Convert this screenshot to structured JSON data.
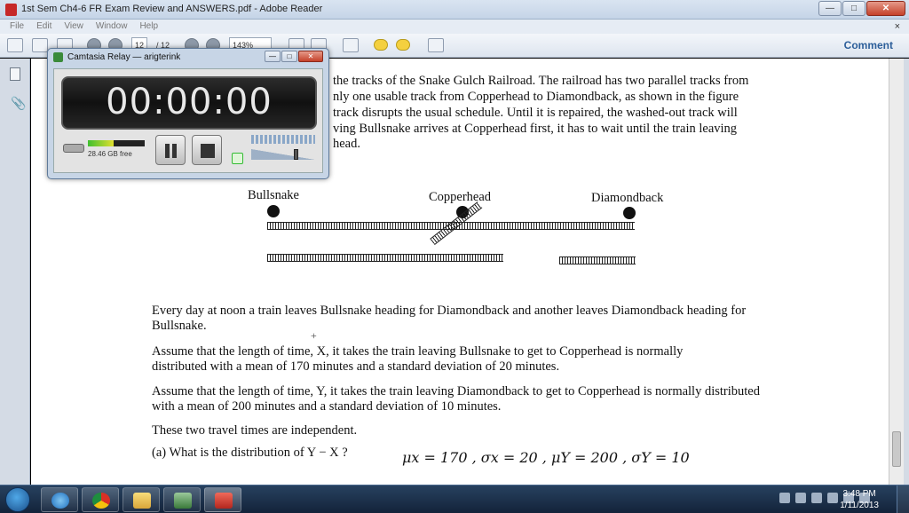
{
  "window": {
    "title": "1st Sem Ch4-6 FR Exam Review and ANSWERS.pdf - Adobe Reader",
    "minimize": "—",
    "maximize": "□",
    "close": "✕"
  },
  "menu": {
    "items": [
      "File",
      "Edit",
      "View",
      "Window",
      "Help"
    ],
    "close_doc": "×"
  },
  "toolbar": {
    "page_current": "12",
    "page_total": "/ 12",
    "zoom": "143%",
    "comment": "Comment"
  },
  "document": {
    "lines_top": [
      "the tracks of the Snake Gulch Railroad. The railroad has two parallel tracks from",
      "nly one usable track from Copperhead to Diamondback, as shown in the figure",
      "track disrupts the usual schedule. Until it is repaired, the washed-out track will",
      "ving Bullsnake arrives at Copperhead first, it has to wait until the train leaving",
      "head."
    ],
    "stations": [
      "Bullsnake",
      "Copperhead",
      "Diamondback"
    ],
    "paragraphs": [
      "Every day at noon a train leaves Bullsnake heading for Diamondback and another leaves Diamondback heading for Bullsnake.",
      "Assume that the length of time, X, it takes the train leaving Bullsnake to get to Copperhead is normally distributed with a mean of 170 minutes and a standard deviation of 20 minutes.",
      "Assume that the length of time, Y, it takes the train leaving Diamondback to get to Copperhead is normally distributed with a mean of 200 minutes and a standard deviation of 10 minutes.",
      "These two travel times are independent."
    ],
    "question_a": "(a)  What is the distribution of  Y − X ?",
    "handwriting": "μx = 170 , σx = 20 , μY = 200 , σY = 10"
  },
  "relay": {
    "title": "Camtasia Relay — arigterink",
    "timer": "00:00:00",
    "disk_free": "28.46 GB free",
    "disk_meter": 0.45
  },
  "taskbar": {
    "time": "3:48 PM",
    "date": "1/11/2013"
  }
}
